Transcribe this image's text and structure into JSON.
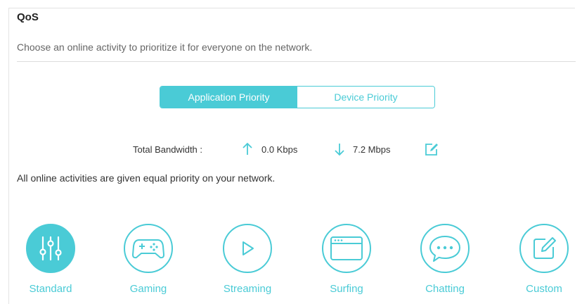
{
  "page": {
    "title": "QoS",
    "subtitle": "Choose an online activity to prioritize it for everyone on the network."
  },
  "tabs": {
    "active": "Application Priority",
    "inactive": "Device Priority"
  },
  "bandwidth": {
    "label": "Total Bandwidth :",
    "upload": "0.0 Kbps",
    "download": "7.2 Mbps"
  },
  "description": "All online activities are given equal priority on your network.",
  "activities": [
    {
      "label": "Standard",
      "icon": "sliders-icon",
      "selected": true
    },
    {
      "label": "Gaming",
      "icon": "gamepad-icon",
      "selected": false
    },
    {
      "label": "Streaming",
      "icon": "play-icon",
      "selected": false
    },
    {
      "label": "Surfing",
      "icon": "browser-window-icon",
      "selected": false
    },
    {
      "label": "Chatting",
      "icon": "chat-bubble-icon",
      "selected": false
    },
    {
      "label": "Custom",
      "icon": "edit-icon",
      "selected": false
    }
  ],
  "colors": {
    "accent": "#4acbd6",
    "text": "#333333",
    "muted": "#666666"
  }
}
